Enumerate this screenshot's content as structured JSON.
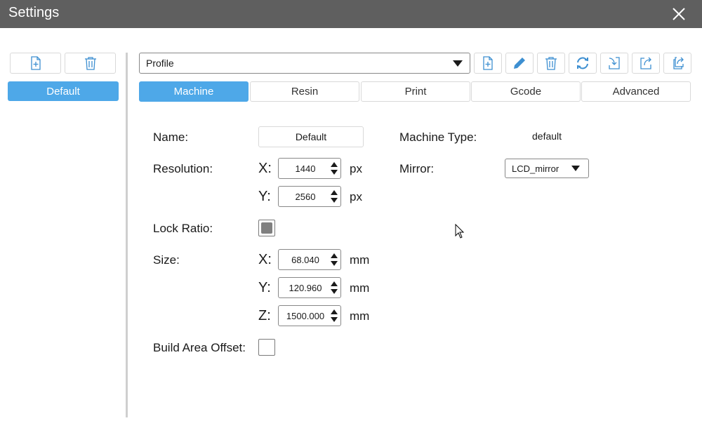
{
  "window": {
    "title": "Settings",
    "close_icon": "close-icon"
  },
  "sidebar": {
    "add_icon": "file-add-icon",
    "delete_icon": "trash-icon",
    "items": [
      {
        "label": "Default",
        "selected": true
      }
    ]
  },
  "profile": {
    "selected": "Profile",
    "toolbar_icons": [
      "file-add-icon",
      "pencil-icon",
      "trash-icon",
      "refresh-icon",
      "import-icon",
      "export-icon",
      "export-all-icon"
    ]
  },
  "tabs": [
    {
      "label": "Machine",
      "active": true
    },
    {
      "label": "Resin",
      "active": false
    },
    {
      "label": "Print",
      "active": false
    },
    {
      "label": "Gcode",
      "active": false
    },
    {
      "label": "Advanced",
      "active": false
    }
  ],
  "machine": {
    "name_label": "Name:",
    "name_value": "Default",
    "resolution_label": "Resolution:",
    "resolution": {
      "x_label": "X:",
      "x_value": "1440",
      "x_unit": "px",
      "y_label": "Y:",
      "y_value": "2560",
      "y_unit": "px"
    },
    "lock_ratio_label": "Lock Ratio:",
    "lock_ratio_checked": true,
    "size_label": "Size:",
    "size": {
      "x_label": "X:",
      "x_value": "68.040",
      "x_unit": "mm",
      "y_label": "Y:",
      "y_value": "120.960",
      "y_unit": "mm",
      "z_label": "Z:",
      "z_value": "1500.000",
      "z_unit": "mm"
    },
    "build_area_offset_label": "Build Area Offset:",
    "build_area_offset_checked": false,
    "machine_type_label": "Machine Type:",
    "machine_type_value": "default",
    "mirror_label": "Mirror:",
    "mirror_value": "LCD_mirror"
  },
  "colors": {
    "accent": "#4ea8e8",
    "titlebar": "#5f5f5f",
    "divider": "#cfcfcf"
  }
}
